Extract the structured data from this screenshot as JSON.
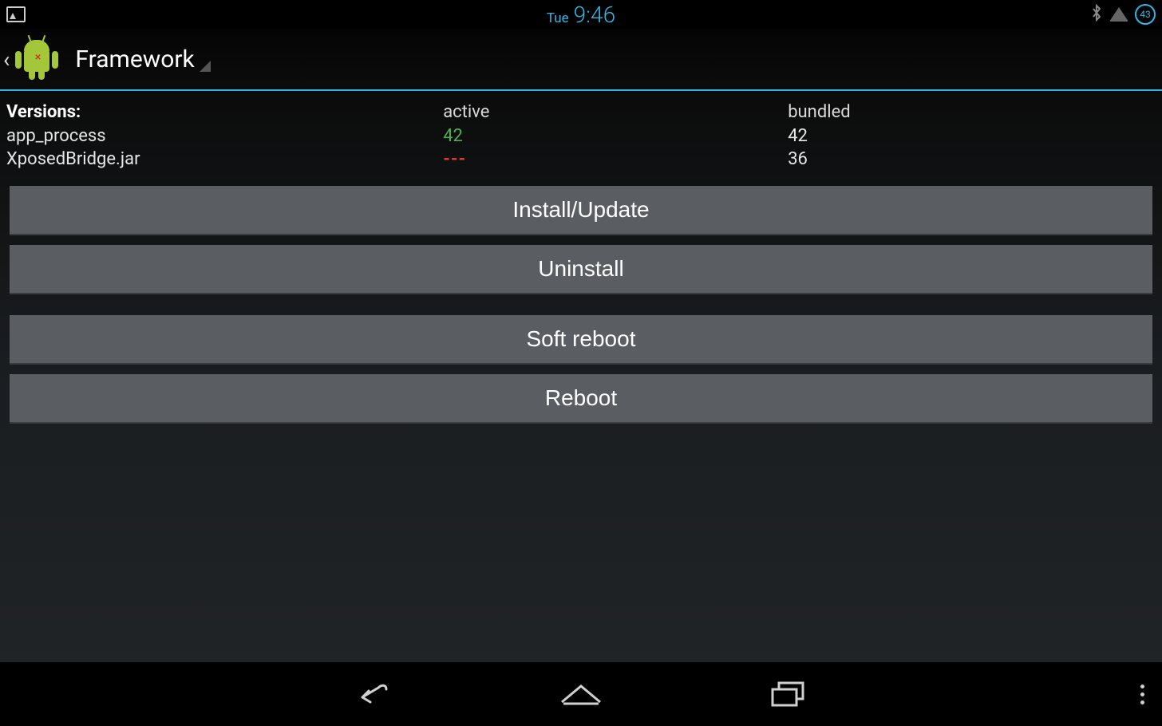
{
  "statusbar": {
    "day": "Tue",
    "time": "9:46",
    "battery": "43"
  },
  "actionbar": {
    "title": "Framework"
  },
  "versions": {
    "header": "Versions:",
    "col_active": "active",
    "col_bundled": "bundled",
    "rows": [
      {
        "name": "app_process",
        "active": "42",
        "active_class": "val-green",
        "bundled": "42"
      },
      {
        "name": "XposedBridge.jar",
        "active": "---",
        "active_class": "val-red",
        "bundled": "36"
      }
    ]
  },
  "buttons": {
    "install": "Install/Update",
    "uninstall": "Uninstall",
    "softreboot": "Soft reboot",
    "reboot": "Reboot"
  }
}
